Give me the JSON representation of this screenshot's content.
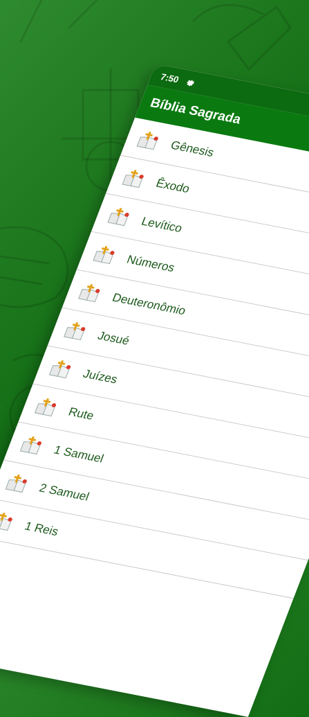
{
  "status_bar": {
    "time": "7:50",
    "settings_icon": "gear-icon"
  },
  "app_bar": {
    "title": "Bíblia Sagrada"
  },
  "books": [
    {
      "label": "Gênesis",
      "icon": "bible-cross-icon"
    },
    {
      "label": "Êxodo",
      "icon": "bible-cross-icon"
    },
    {
      "label": "Levítico",
      "icon": "bible-cross-icon"
    },
    {
      "label": "Números",
      "icon": "bible-cross-icon"
    },
    {
      "label": "Deuteronômio",
      "icon": "bible-cross-icon"
    },
    {
      "label": "Josué",
      "icon": "bible-cross-icon"
    },
    {
      "label": "Juízes",
      "icon": "bible-cross-icon"
    },
    {
      "label": "Rute",
      "icon": "bible-cross-icon"
    },
    {
      "label": "1 Samuel",
      "icon": "bible-cross-icon"
    },
    {
      "label": "2 Samuel",
      "icon": "bible-cross-icon"
    },
    {
      "label": "1 Reis",
      "icon": "bible-cross-icon"
    }
  ],
  "colors": {
    "background": "#1f7a1f",
    "status_bar": "#0c6a10",
    "app_bar": "#0a7a10",
    "list_text": "#1d5a1d",
    "divider": "#c8c8c8"
  }
}
